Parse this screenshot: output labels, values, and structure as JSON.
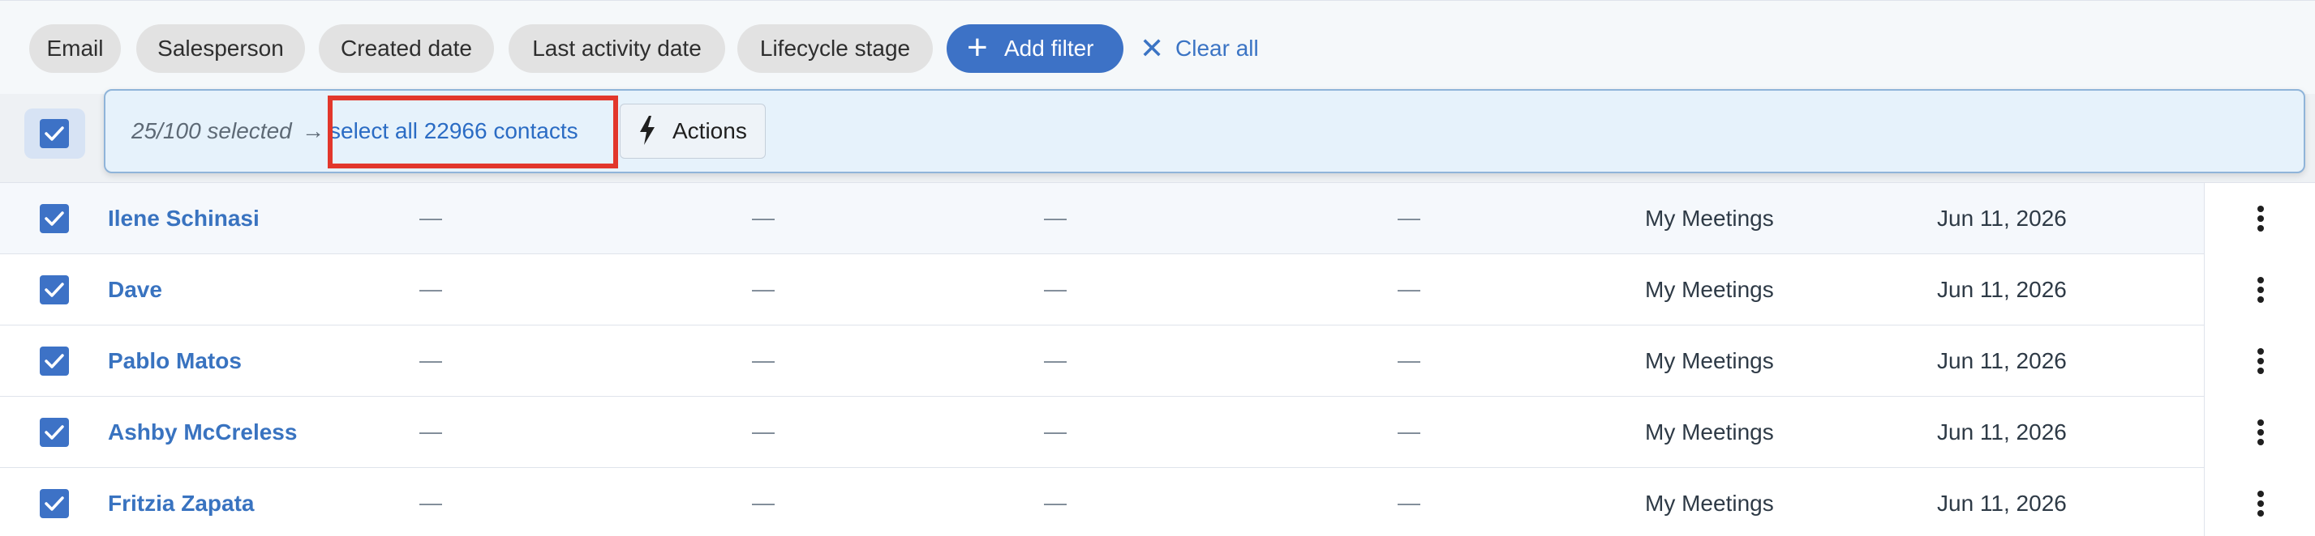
{
  "filters": {
    "chips": [
      "Email",
      "Salesperson",
      "Created date",
      "Last activity date",
      "Lifecycle stage"
    ],
    "add_filter_label": "Add filter",
    "clear_all_label": "Clear all"
  },
  "selection": {
    "count_text": "25/100 selected",
    "arrow": "→",
    "select_all_text": "select all 22966 contacts",
    "actions_label": "Actions"
  },
  "colors": {
    "accent": "#3d72c6",
    "link": "#3973c0",
    "highlight": "#e2372b",
    "checkbox": "#3d72c6"
  },
  "icons": {
    "add": "plus-icon",
    "clear": "close-icon",
    "actions": "lightning-bolt-icon",
    "row_menu": "vertical-dots-icon"
  },
  "rows": [
    {
      "name": "Ilene Schinasi",
      "c1": "—",
      "c2": "—",
      "c3": "—",
      "c4": "—",
      "source": "My Meetings",
      "date": "Jun 11, 2026",
      "checked": true
    },
    {
      "name": "Dave",
      "c1": "—",
      "c2": "—",
      "c3": "—",
      "c4": "—",
      "source": "My Meetings",
      "date": "Jun 11, 2026",
      "checked": true
    },
    {
      "name": "Pablo Matos",
      "c1": "—",
      "c2": "—",
      "c3": "—",
      "c4": "—",
      "source": "My Meetings",
      "date": "Jun 11, 2026",
      "checked": true
    },
    {
      "name": "Ashby McCreless",
      "c1": "—",
      "c2": "—",
      "c3": "—",
      "c4": "—",
      "source": "My Meetings",
      "date": "Jun 11, 2026",
      "checked": true
    },
    {
      "name": "Fritzia Zapata",
      "c1": "—",
      "c2": "—",
      "c3": "—",
      "c4": "—",
      "source": "My Meetings",
      "date": "Jun 11, 2026",
      "checked": true
    }
  ]
}
